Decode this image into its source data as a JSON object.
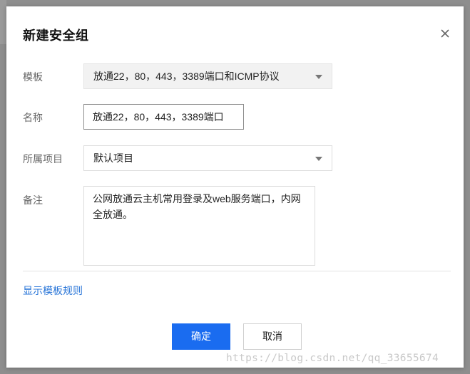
{
  "dialog": {
    "title": "新建安全组",
    "close_icon": "close-icon"
  },
  "form": {
    "template_label": "模板",
    "template_value": "放通22，80，443，3389端口和ICMP协议",
    "name_label": "名称",
    "name_value": "放通22，80，443，3389端口",
    "project_label": "所属项目",
    "project_value": "默认项目",
    "remark_label": "备注",
    "remark_value": "公网放通云主机常用登录及web服务端口，内网全放通。"
  },
  "actions": {
    "show_rules_link": "显示模板规则",
    "confirm_label": "确定",
    "cancel_label": "取消"
  },
  "watermark": "https://blog.csdn.net/qq_33655674",
  "colors": {
    "primary": "#1a6cf0",
    "link": "#2a76d8",
    "select_bg": "#f2f2f2"
  }
}
